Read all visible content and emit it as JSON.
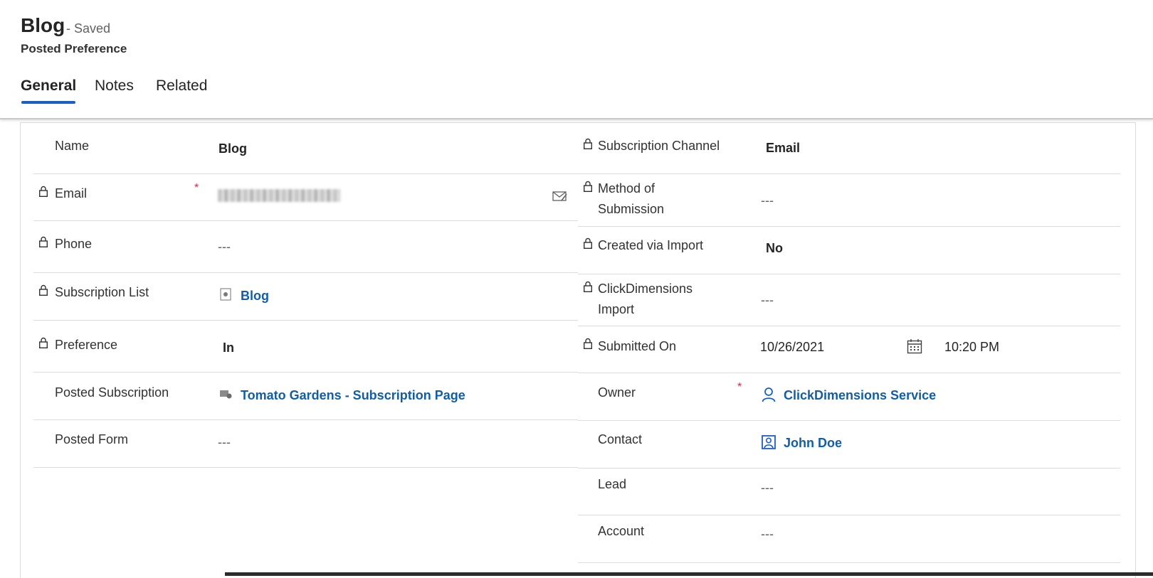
{
  "header": {
    "title": "Blog",
    "status": "- Saved",
    "entity": "Posted Preference"
  },
  "tabs": [
    {
      "label": "General",
      "active": true
    },
    {
      "label": "Notes",
      "active": false
    },
    {
      "label": "Related",
      "active": false
    }
  ],
  "left_fields": {
    "name": {
      "label": "Name",
      "value": "Blog"
    },
    "email": {
      "label": "Email",
      "required": "*"
    },
    "phone": {
      "label": "Phone",
      "value": "---"
    },
    "subscription_list": {
      "label": "Subscription List",
      "value": "Blog"
    },
    "preference": {
      "label": "Preference",
      "value": "In"
    },
    "posted_subscription": {
      "label": "Posted Subscription",
      "value": "Tomato Gardens - Subscription Page"
    },
    "posted_form": {
      "label": "Posted Form",
      "value": "---"
    }
  },
  "right_fields": {
    "subscription_channel": {
      "label": "Subscription Channel",
      "value": "Email"
    },
    "method_of_submission": {
      "label_line1": "Method of",
      "label_line2": "Submission",
      "value": "---"
    },
    "created_via_import": {
      "label": "Created via Import",
      "value": "No"
    },
    "clickdimensions_import": {
      "label_line1": "ClickDimensions",
      "label_line2": "Import",
      "value": "---"
    },
    "submitted_on": {
      "label": "Submitted On",
      "date": "10/26/2021",
      "time": "10:20 PM"
    },
    "owner": {
      "label": "Owner",
      "required": "*",
      "value": "ClickDimensions Service"
    },
    "contact": {
      "label": "Contact",
      "value": "John Doe"
    },
    "lead": {
      "label": "Lead",
      "value": "---"
    },
    "account": {
      "label": "Account",
      "value": "---"
    }
  },
  "colors": {
    "accent": "#1a5ec8",
    "link": "#115ea3",
    "required": "#c4314b"
  }
}
